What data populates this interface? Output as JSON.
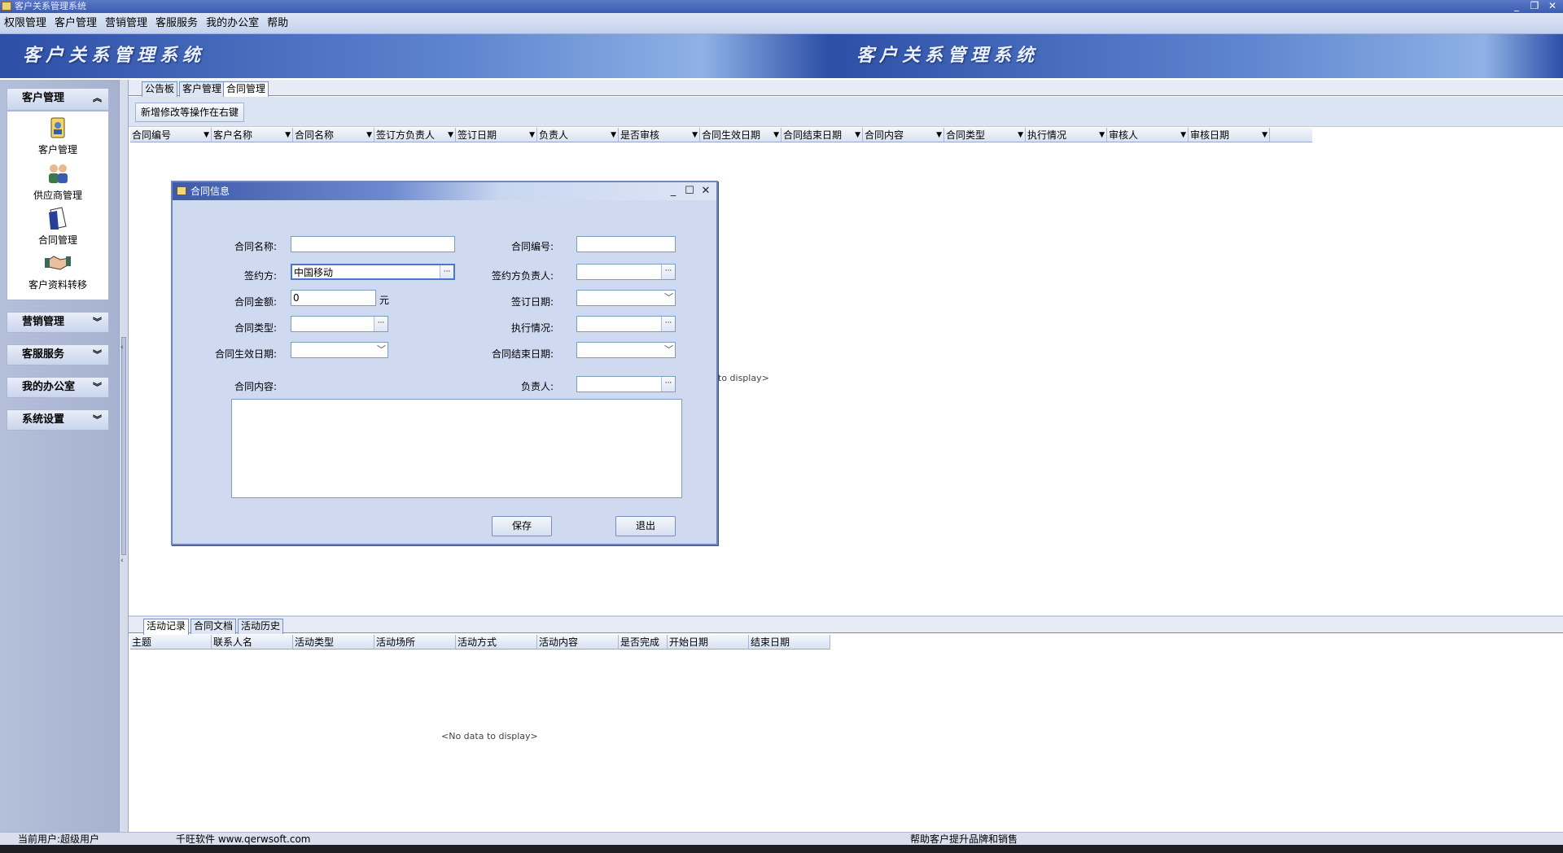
{
  "window": {
    "title": "客户关系管理系统"
  },
  "menu": [
    "权限管理",
    "客户管理",
    "营销管理",
    "客服服务",
    "我的办公室",
    "帮助"
  ],
  "banner": {
    "title_left": "客户关系管理系统",
    "title_right": "客户关系管理系统"
  },
  "sidebar": {
    "active_group": "客户管理",
    "items": [
      {
        "label": "客户管理",
        "icon": "customer-icon"
      },
      {
        "label": "供应商管理",
        "icon": "supplier-icon"
      },
      {
        "label": "合同管理",
        "icon": "contract-icon"
      },
      {
        "label": "客户资料转移",
        "icon": "handshake-icon"
      }
    ],
    "groups": [
      "营销管理",
      "客服服务",
      "我的办公室",
      "系统设置"
    ]
  },
  "main": {
    "tabs": [
      "公告板",
      "客户管理",
      "合同管理"
    ],
    "toolbar_button": "新增修改等操作在右键",
    "columns": [
      "合同编号",
      "客户名称",
      "合同名称",
      "签订方负责人",
      "签订日期",
      "负责人",
      "是否审核",
      "合同生效日期",
      "合同结束日期",
      "合同内容",
      "合同类型",
      "执行情况",
      "审核人",
      "审核日期"
    ],
    "no_data_partial": "to display>"
  },
  "bottom": {
    "tabs": [
      "活动记录",
      "合同文档",
      "活动历史"
    ],
    "columns": [
      "主题",
      "联系人名",
      "活动类型",
      "活动场所",
      "活动方式",
      "活动内容",
      "是否完成",
      "开始日期",
      "结束日期"
    ],
    "no_data": "<No data to display>"
  },
  "dialog": {
    "title": "合同信息",
    "labels": {
      "contract_name": "合同名称:",
      "contract_no": "合同编号:",
      "signer": "签约方:",
      "signer_owner": "签约方负责人:",
      "amount": "合同金额:",
      "sign_date": "签订日期:",
      "type": "合同类型:",
      "execution": "执行情况:",
      "start_date": "合同生效日期:",
      "end_date": "合同结束日期:",
      "content": "合同内容:",
      "owner": "负责人:"
    },
    "values": {
      "contract_name": "",
      "contract_no": "",
      "signer": "中国移动",
      "signer_owner": "",
      "amount": "0",
      "type": "",
      "execution": "",
      "owner": ""
    },
    "amount_unit": "元",
    "save": "保存",
    "exit": "退出"
  },
  "status": {
    "user": "当前用户:超级用户",
    "company": "千旺软件 www.qerwsoft.com",
    "slogan": "帮助客户提升品牌和销售"
  }
}
